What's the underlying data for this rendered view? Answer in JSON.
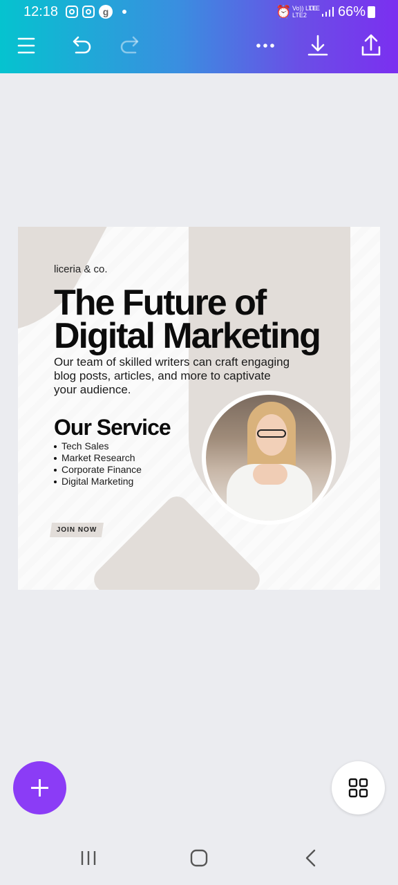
{
  "status_bar": {
    "time": "12:18",
    "network_top": "Vo)) LTE",
    "network_bottom": "LTE2",
    "lte_label": "LTE",
    "battery": "66%",
    "g_icon_letter": "g"
  },
  "toolbar": {
    "menu_icon": "menu-icon",
    "undo_icon": "undo-icon",
    "redo_icon": "redo-icon",
    "more_icon": "more-icon",
    "download_icon": "download-icon",
    "share_icon": "share-icon"
  },
  "design": {
    "brand": "liceria & co.",
    "headline_line1": "The Future of",
    "headline_line2": "Digital Marketing",
    "body_line1": "Our team of skilled writers can craft engaging",
    "body_line2": "blog posts, articles, and more to captivate",
    "body_line3": "your audience.",
    "service_title": "Our Service",
    "services": [
      "Tech Sales",
      "Market Research",
      "Corporate Finance",
      "Digital Marketing"
    ],
    "cta": "JOIN NOW",
    "accent_color": "#e2ddd9"
  },
  "colors": {
    "gradient_start": "#05c3cf",
    "gradient_end": "#7b2ff0",
    "fab_purple": "#8b3cf6",
    "canvas_background": "#ebecf0"
  }
}
